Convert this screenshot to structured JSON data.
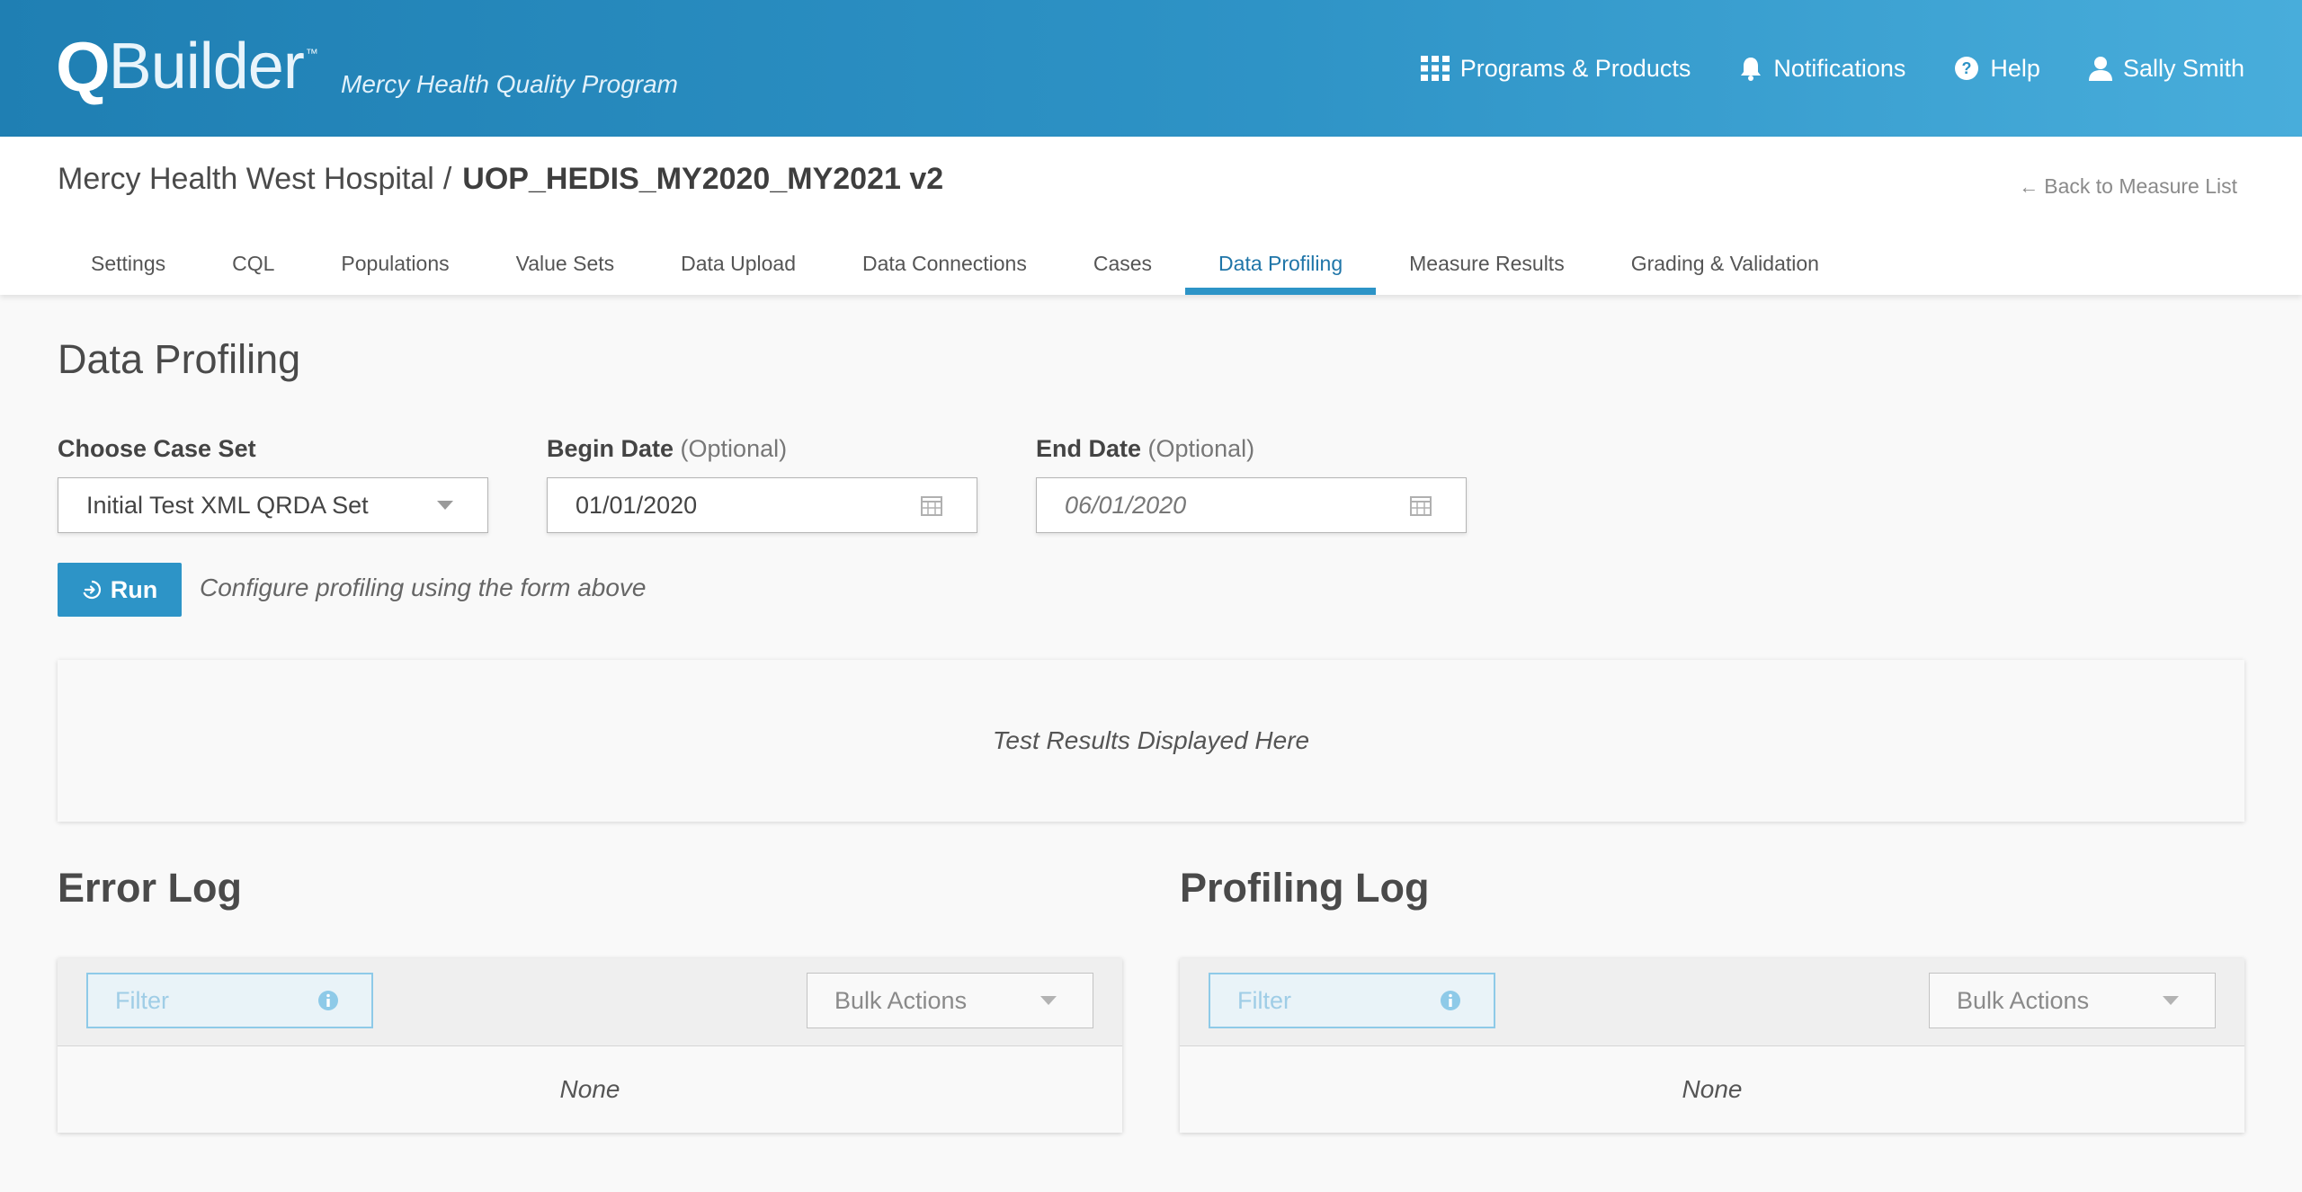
{
  "app": {
    "logo_q": "Q",
    "logo_rest": "Builder",
    "logo_tm": "™",
    "program": "Mercy Health Quality Program"
  },
  "topnav": {
    "programs": "Programs & Products",
    "notifications": "Notifications",
    "help": "Help",
    "user": "Sally Smith"
  },
  "breadcrumb": {
    "org": "Mercy Health West Hospital",
    "separator": "/",
    "measure": "UOP_HEDIS_MY2020_MY2021 v2"
  },
  "back_link": "Back to Measure List",
  "tabs": [
    {
      "label": "Settings"
    },
    {
      "label": "CQL"
    },
    {
      "label": "Populations"
    },
    {
      "label": "Value Sets"
    },
    {
      "label": "Data Upload"
    },
    {
      "label": "Data Connections"
    },
    {
      "label": "Cases"
    },
    {
      "label": "Data Profiling",
      "active": true
    },
    {
      "label": "Measure Results"
    },
    {
      "label": "Grading & Validation"
    }
  ],
  "page_title": "Data Profiling",
  "form": {
    "case_set_label": "Choose Case Set",
    "case_set_value": "Initial Test XML QRDA Set",
    "begin_label": "Begin Date",
    "begin_optional": "(Optional)",
    "begin_value": "01/01/2020",
    "end_label": "End Date",
    "end_optional": "(Optional)",
    "end_placeholder": "06/01/2020",
    "run_label": "Run",
    "hint": "Configure profiling using the form above"
  },
  "results_placeholder": "Test Results Displayed Here",
  "error_log": {
    "title": "Error Log",
    "filter_placeholder": "Filter",
    "bulk_label": "Bulk Actions",
    "empty": "None"
  },
  "profiling_log": {
    "title": "Profiling Log",
    "filter_placeholder": "Filter",
    "bulk_label": "Bulk Actions",
    "empty": "None"
  },
  "colors": {
    "header_start": "#1f7fb3",
    "header_end": "#48addb",
    "accent": "#2d94c7",
    "active_tab_text": "#1f75a8"
  },
  "icons": {
    "programs": "grid-icon",
    "notifications": "bell-icon",
    "help": "question-circle-icon",
    "user": "user-icon",
    "back": "arrow-left-icon",
    "calendar": "calendar-icon",
    "run": "sign-in-arrow-icon",
    "filter_info": "info-circle-icon",
    "dropdown": "chevron-down-icon"
  }
}
